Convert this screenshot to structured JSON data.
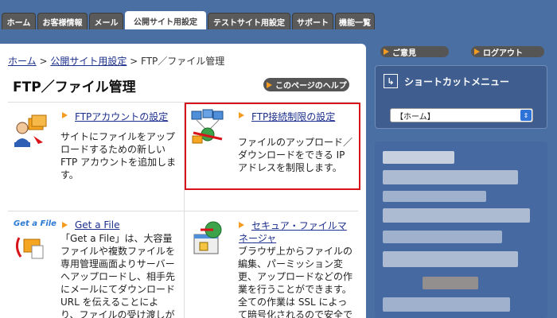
{
  "tabs": [
    {
      "label": "ホーム",
      "active": false
    },
    {
      "label": "お客様情報",
      "active": false
    },
    {
      "label": "メール",
      "active": false
    },
    {
      "label": "公開サイト用設定",
      "active": true
    },
    {
      "label": "テストサイト用設定",
      "active": false
    },
    {
      "label": "サポート",
      "active": false
    },
    {
      "label": "機能一覧",
      "active": false
    }
  ],
  "breadcrumb": {
    "home": "ホーム",
    "sep1": " > ",
    "parent": "公開サイト用設定",
    "sep2": " > ",
    "current": "FTP／ファイル管理"
  },
  "page_title": "FTP／ファイル管理",
  "help_button": "このページのヘルプ",
  "cards": [
    {
      "title": "FTPアカウントの設定",
      "text": [
        "サイトにファイルをアップ",
        "ロードするための新しい",
        "FTP アカウントを追加しま",
        "す。"
      ],
      "icon": "ftp-account-icon"
    },
    {
      "title": "FTP接続制限の設定",
      "text": [
        "ファイルのアップロード／",
        "ダウンロードをできる IP",
        "アドレスを制限します。"
      ],
      "icon": "ftp-restriction-icon"
    },
    {
      "title": "Get a File",
      "text": [
        "「Get a File」は、大容量",
        "ファイルや複数ファイルを",
        "専用管理画面よりサーバー",
        "へアップロードし、相手先",
        "にメールにてダウンロード",
        "URL を伝えることによ",
        "り、ファイルの受け渡しが"
      ],
      "icon": "get-a-file-icon",
      "logo_text": "Get a File"
    },
    {
      "title_lines": [
        "セキュア・ファイルマ",
        "ネージャ"
      ],
      "text": [
        "ブラウザ上からファイルの",
        "編集、パーミッション変",
        "更、アップロードなどの作",
        "業を行うことができます。",
        "全ての作業は SSL によっ",
        "て暗号化されるので安全で"
      ],
      "icon": "secure-file-manager-icon"
    }
  ],
  "header_links": {
    "feedback": "ご意見",
    "logout": "ログアウト"
  },
  "shortcut_menu": {
    "title": "ショートカットメニュー",
    "selected": "【ホーム】"
  },
  "colors": {
    "accent": "#f39c1f",
    "link": "#1b2f8c",
    "highlight": "#d7141a",
    "background": "#4a6fa3"
  }
}
